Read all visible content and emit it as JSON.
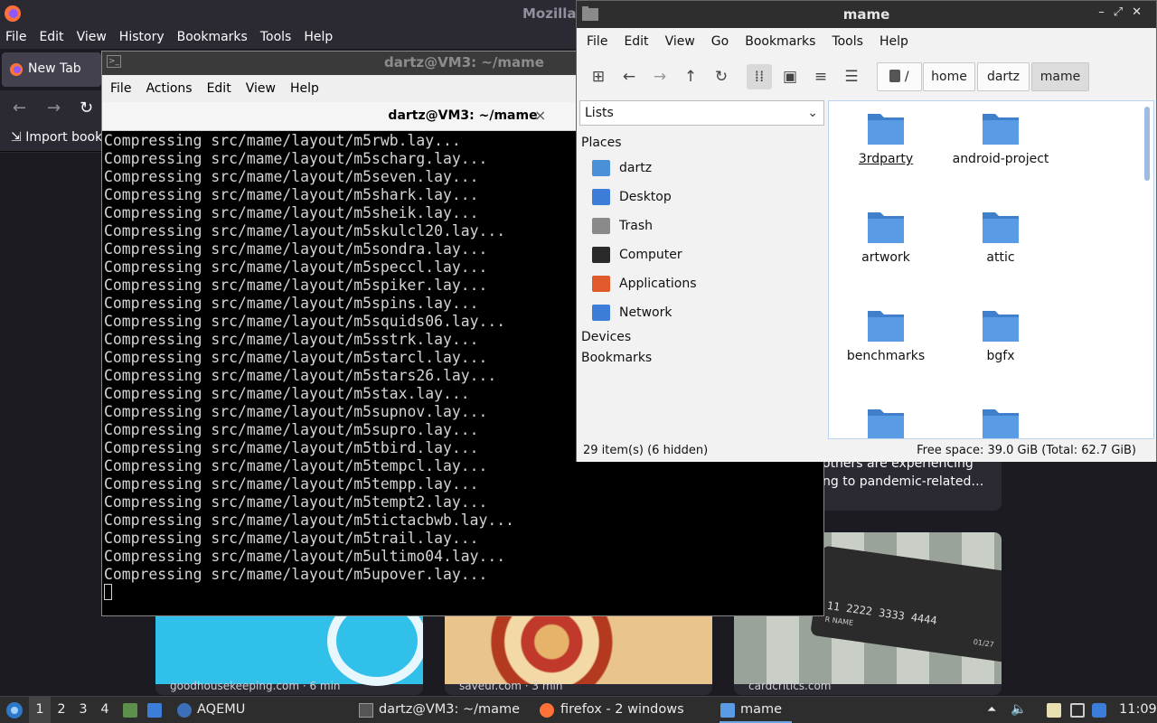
{
  "firefox": {
    "title": "Mozilla",
    "menu": [
      "File",
      "Edit",
      "View",
      "History",
      "Bookmarks",
      "Tools",
      "Help"
    ],
    "tab_label": "New Tab",
    "nav_icons": [
      "back-icon",
      "forward-icon",
      "reload-icon"
    ],
    "import_bookmarks": "Import book",
    "cards": [
      {
        "site": "",
        "text": "others are experiencing",
        "text2": "ng to pandemic-related…"
      },
      {
        "site": "goodhousekeeping.com · 6 min"
      },
      {
        "site": "saveur.com · 3 min"
      },
      {
        "site": "cardcritics.com"
      }
    ],
    "card_print": {
      "numbers": "11 2222 3333 4444",
      "name": "R NAME",
      "expiry": "01/27"
    },
    "colors": {
      "bg": "#1c1b22",
      "toolbar": "#2b2a33",
      "card_blue": "#30c0ea"
    }
  },
  "terminal": {
    "window_title": "dartz@VM3: ~/mame",
    "menu": [
      "File",
      "Actions",
      "Edit",
      "View",
      "Help"
    ],
    "tab_title": "dartz@VM3: ~/mame",
    "close_glyph": "×",
    "lines": [
      "Compressing src/mame/layout/m5rwb.lay...",
      "Compressing src/mame/layout/m5scharg.lay...",
      "Compressing src/mame/layout/m5seven.lay...",
      "Compressing src/mame/layout/m5shark.lay...",
      "Compressing src/mame/layout/m5sheik.lay...",
      "Compressing src/mame/layout/m5skulcl20.lay...",
      "Compressing src/mame/layout/m5sondra.lay...",
      "Compressing src/mame/layout/m5speccl.lay...",
      "Compressing src/mame/layout/m5spiker.lay...",
      "Compressing src/mame/layout/m5spins.lay...",
      "Compressing src/mame/layout/m5squids06.lay...",
      "Compressing src/mame/layout/m5sstrk.lay...",
      "Compressing src/mame/layout/m5starcl.lay...",
      "Compressing src/mame/layout/m5stars26.lay...",
      "Compressing src/mame/layout/m5stax.lay...",
      "Compressing src/mame/layout/m5supnov.lay...",
      "Compressing src/mame/layout/m5supro.lay...",
      "Compressing src/mame/layout/m5tbird.lay...",
      "Compressing src/mame/layout/m5tempcl.lay...",
      "Compressing src/mame/layout/m5tempp.lay...",
      "Compressing src/mame/layout/m5tempt2.lay...",
      "Compressing src/mame/layout/m5tictacbwb.lay...",
      "Compressing src/mame/layout/m5trail.lay...",
      "Compressing src/mame/layout/m5ultimo04.lay...",
      "Compressing src/mame/layout/m5upover.lay..."
    ]
  },
  "filemanager": {
    "title": "mame",
    "window_buttons": "–⤢✕",
    "menu": [
      "File",
      "Edit",
      "View",
      "Go",
      "Bookmarks",
      "Tools",
      "Help"
    ],
    "toolbar_icons": [
      "new-tab-icon",
      "back-icon",
      "forward-icon",
      "up-icon",
      "reload-icon",
      "icon-view-icon",
      "thumbnail-view-icon",
      "compact-view-icon",
      "detailed-list-icon"
    ],
    "path": [
      "/",
      "home",
      "dartz",
      "mame"
    ],
    "side_select": "Lists",
    "places_heading": "Places",
    "places": [
      {
        "label": "dartz",
        "icon": "home-folder-icon",
        "color": "#4a90d9"
      },
      {
        "label": "Desktop",
        "icon": "desktop-icon",
        "color": "#3b7dd8"
      },
      {
        "label": "Trash",
        "icon": "trash-icon",
        "color": "#8a8a8a"
      },
      {
        "label": "Computer",
        "icon": "computer-icon",
        "color": "#2a2a2a"
      },
      {
        "label": "Applications",
        "icon": "applications-icon",
        "color": "#e05a2b"
      },
      {
        "label": "Network",
        "icon": "network-icon",
        "color": "#3b7dd8"
      }
    ],
    "devices_heading": "Devices",
    "bookmarks_heading": "Bookmarks",
    "folders": [
      "3rdparty",
      "android-project",
      "artwork",
      "attic",
      "benchmarks",
      "bgfx",
      "",
      ""
    ],
    "status_items": "29 item(s) (6 hidden)",
    "status_free": "Free space: 39.0 GiB (Total: 62.7 GiB)",
    "colors": {
      "folder": "#5a9be6",
      "folder_dark": "#3f7fcc"
    }
  },
  "taskbar": {
    "desktops": [
      "1",
      "2",
      "3",
      "4"
    ],
    "items": [
      {
        "label": "AQEMU",
        "icon": "qemu-icon"
      },
      {
        "label": "dartz@VM3: ~/mame",
        "icon": "terminal-icon"
      },
      {
        "label": "firefox - 2 windows",
        "icon": "firefox-icon"
      },
      {
        "label": "mame",
        "icon": "folder-icon"
      }
    ],
    "clock": "11:09"
  }
}
